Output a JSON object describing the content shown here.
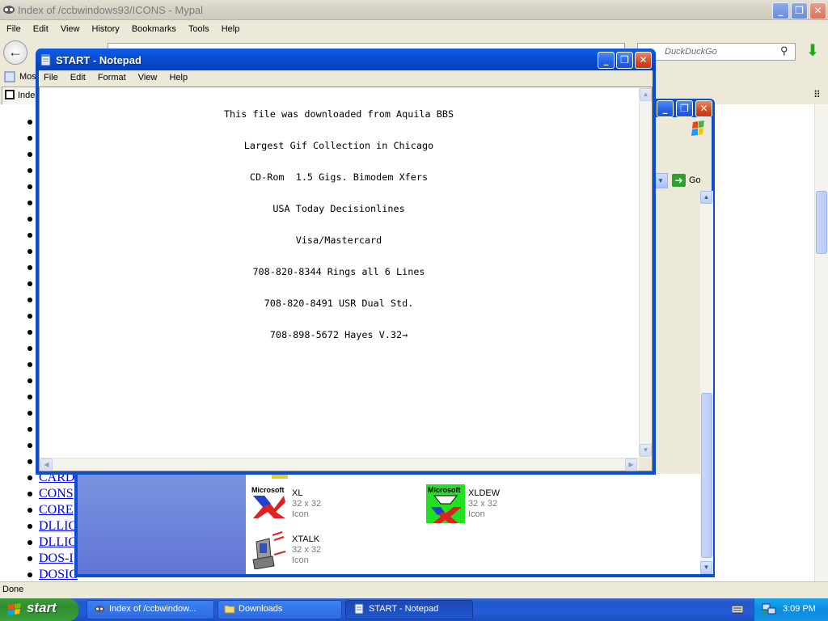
{
  "browser": {
    "title": "Index of /ccbwindows93/ICONS - Mypal",
    "menu": [
      "File",
      "Edit",
      "View",
      "History",
      "Bookmarks",
      "Tools",
      "Help"
    ],
    "search_placeholder": "DuckDuckGo",
    "bookmark_label": "Most",
    "tab_label": "Inde",
    "status": "Done",
    "links": [
      "CARD",
      "CONS",
      "CORE",
      "DLLIC",
      "DLLIC",
      "DOS-I",
      "DOSIC"
    ]
  },
  "explorer": {
    "go_label": "Go",
    "files": [
      {
        "name": "XL",
        "size": "32 x 32",
        "type": "Icon"
      },
      {
        "name": "XLDEW",
        "size": "32 x 32",
        "type": "Icon"
      },
      {
        "name": "XTALK",
        "size": "32 x 32",
        "type": "Icon"
      }
    ]
  },
  "notepad": {
    "title": "START - Notepad",
    "menu": [
      "File",
      "Edit",
      "Format",
      "View",
      "Help"
    ],
    "lines": [
      "This file was downloaded from Aquila BBS",
      "Largest Gif Collection in Chicago",
      "CD-Rom  1.5 Gigs. Bimodem Xfers",
      "USA Today Decisionlines",
      "Visa/Mastercard",
      "708-820-8344 Rings all 6 Lines",
      "708-820-8491 USR Dual Std.",
      "708-898-5672 Hayes V.32→"
    ]
  },
  "taskbar": {
    "start_label": "start",
    "tasks": [
      "Index of /ccbwindow...",
      "Downloads",
      "START - Notepad"
    ],
    "clock": "3:09 PM"
  },
  "colors": {
    "xp_title_blue": "#0A4FD0",
    "start_green": "#3C9A3C",
    "taskbar_blue": "#245DDA",
    "link_blue": "#0000EE"
  }
}
